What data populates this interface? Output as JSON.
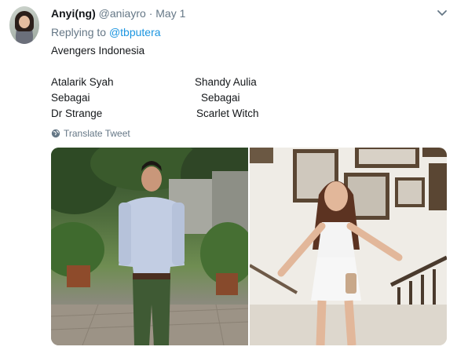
{
  "tweet": {
    "display_name": "Anyi(ng)",
    "handle": "@aniayro",
    "separator": "·",
    "date": "May 1",
    "replying_prefix": "Replying to",
    "replying_to": "@tbputera",
    "title_line": "Avengers Indonesia",
    "cast": {
      "left": {
        "name": "Atalarik Syah",
        "as": "Sebagai",
        "role": "Dr Strange"
      },
      "right": {
        "name": "Shandy Aulia",
        "as": "Sebagai",
        "role": "Scarlet Witch"
      }
    },
    "translate_label": "Translate Tweet",
    "icons": {
      "menu": "chevron-down-icon",
      "translate": "globe-icon"
    },
    "colors": {
      "link": "#1b95e0",
      "secondary_text": "#657786",
      "primary_text": "#14171a"
    }
  }
}
